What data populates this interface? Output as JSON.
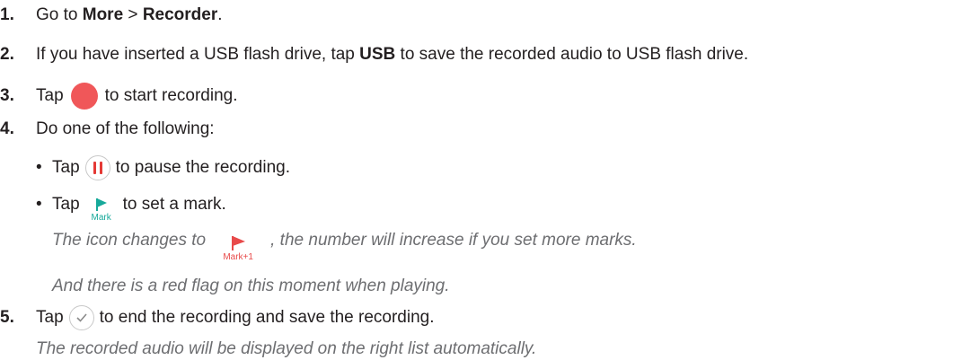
{
  "steps": [
    {
      "num": "1.",
      "pre": "Go to ",
      "b1": "More",
      "mid": " > ",
      "b2": "Recorder",
      "post": "."
    },
    {
      "num": "2.",
      "pre": "If you have inserted a USB flash drive, tap ",
      "b1": "USB",
      "post": " to save the recorded audio to USB flash drive."
    },
    {
      "num": "3.",
      "pre": "Tap",
      "post": "to start recording.",
      "icon": "record-icon"
    },
    {
      "num": "4.",
      "text": "Do one of the following:"
    },
    {
      "num": "5.",
      "pre": "Tap",
      "post": "to end the recording and save the recording.",
      "icon": "check-circle-icon"
    }
  ],
  "bullets": [
    {
      "dot": "•",
      "pre": "Tap",
      "post": "to pause the recording.",
      "icon": "pause-icon"
    },
    {
      "dot": "•",
      "pre": "Tap",
      "post": "to set a mark.",
      "icon": "flag-icon",
      "icon_label": "Mark"
    }
  ],
  "notes": {
    "mark_change_pre": "The icon changes to",
    "mark_change_post": ", the number will increase if you set more marks.",
    "mark_change_icon_label": "Mark+1",
    "red_flag": "And there is a red flag on this moment when playing.",
    "recorded_list": "The recorded audio will be displayed on the right list automatically."
  },
  "colors": {
    "record": "#f05759",
    "pause_bars": "#e53935",
    "mark_teal": "#17a99a",
    "mark_red": "#e84a4a",
    "note_text": "#6d6e71"
  }
}
